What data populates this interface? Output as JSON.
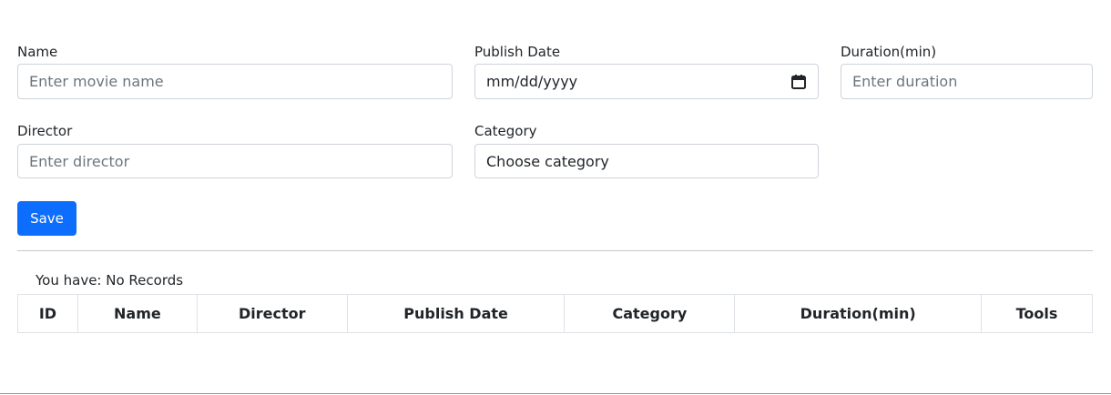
{
  "form": {
    "name": {
      "label": "Name",
      "placeholder": "Enter movie name",
      "value": ""
    },
    "publish_date": {
      "label": "Publish Date",
      "placeholder": "mm/dd/yyyy",
      "icon": "calendar-icon"
    },
    "duration": {
      "label": "Duration(min)",
      "placeholder": "Enter duration",
      "value": ""
    },
    "director": {
      "label": "Director",
      "placeholder": "Enter director",
      "value": ""
    },
    "category": {
      "label": "Category",
      "selected": "Choose category"
    },
    "save_label": "Save"
  },
  "records": {
    "summary": "You have: No Records",
    "columns": [
      "ID",
      "Name",
      "Director",
      "Publish Date",
      "Category",
      "Duration(min)",
      "Tools"
    ]
  },
  "colors": {
    "primary": "#0d6efd",
    "border": "#ced4da",
    "table_border": "#dee2e6",
    "footer_line": "#20c997"
  }
}
